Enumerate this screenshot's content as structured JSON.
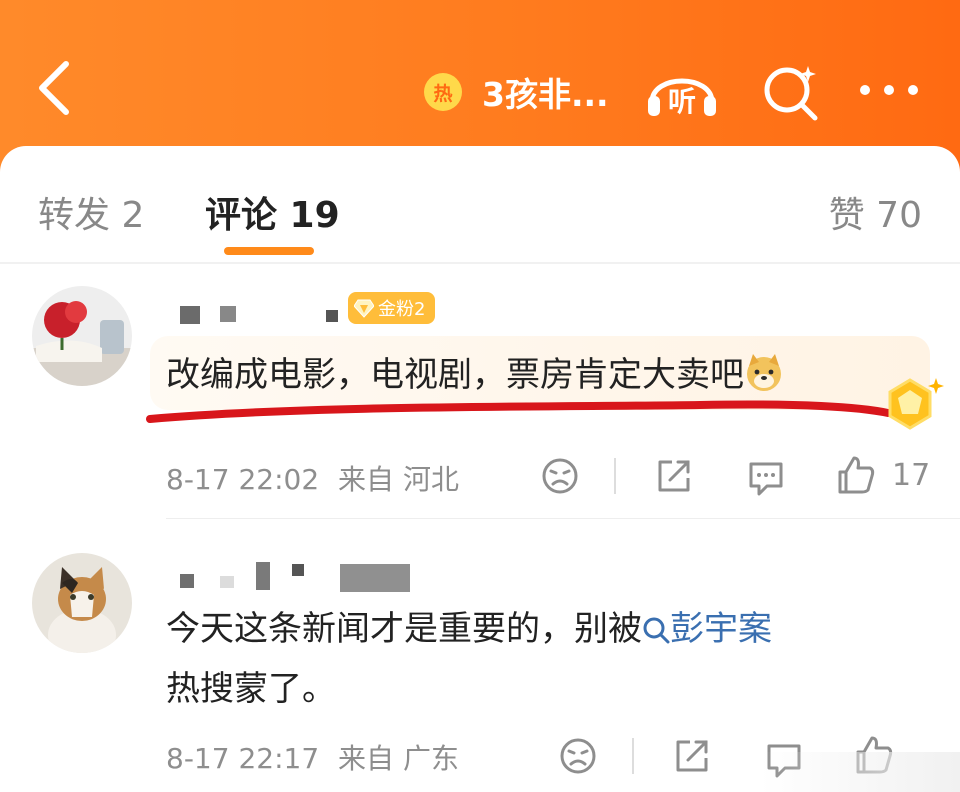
{
  "header": {
    "back_icon": "chevron-left-icon",
    "hot_badge": "热",
    "hot_title": "3孩非...",
    "listen_label": "听",
    "icons": [
      "listen-headphones-icon",
      "search-icon",
      "more-icon"
    ],
    "color": "#ff7b1e"
  },
  "tabs": [
    {
      "label": "转发 2",
      "active": false
    },
    {
      "label": "评论 19",
      "active": true
    },
    {
      "label": "赞 70",
      "active": false
    }
  ],
  "comments": [
    {
      "fan_badge": "金粉2",
      "text": "改编成电影，电视剧，票房肯定大卖吧",
      "emoji": "doge-emoji",
      "time": "8-17 22:02",
      "location": "来自 河北",
      "likes": "17"
    },
    {
      "text_before": "今天这条新闻才是重要的，别被",
      "topic": "彭宇案",
      "text_line2": "热搜蒙了。",
      "time": "8-17 22:17",
      "location": "来自 广东"
    }
  ],
  "colors": {
    "accent": "#ff8a1a",
    "link": "#3a6fb0",
    "annotation": "#d8161b"
  }
}
